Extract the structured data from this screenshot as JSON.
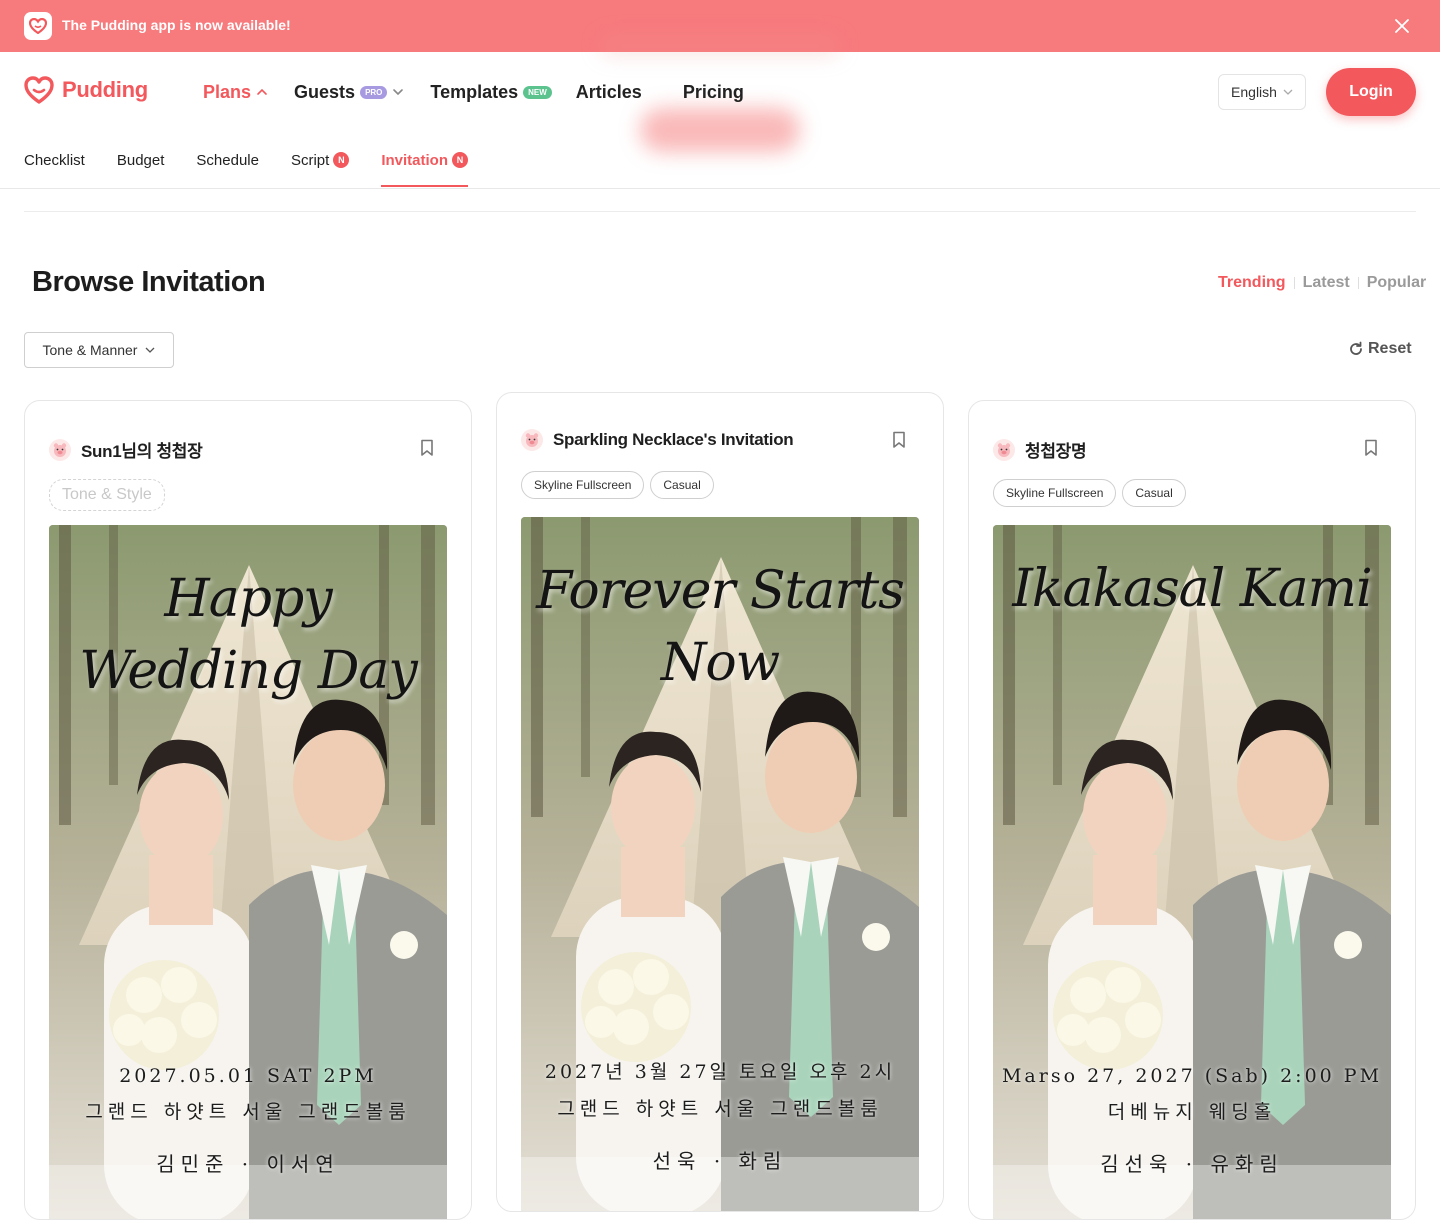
{
  "banner": {
    "text": "The Pudding app is now available!",
    "icon": "pudding-logo-icon",
    "close_icon": "close-icon"
  },
  "header": {
    "logo_text": "Pudding",
    "nav": [
      {
        "label": "Plans",
        "badge": "",
        "chevron": "up"
      },
      {
        "label": "Guests",
        "badge": "PRO",
        "chevron": "down"
      },
      {
        "label": "Templates",
        "badge": "NEW",
        "chevron": ""
      },
      {
        "label": "Articles",
        "badge": "",
        "chevron": ""
      },
      {
        "label": "Pricing",
        "badge": "",
        "chevron": ""
      }
    ],
    "language": "English",
    "login_label": "Login"
  },
  "subnav": [
    {
      "label": "Checklist",
      "badge": ""
    },
    {
      "label": "Budget",
      "badge": ""
    },
    {
      "label": "Schedule",
      "badge": ""
    },
    {
      "label": "Script",
      "badge": "N"
    },
    {
      "label": "Invitation",
      "badge": "N"
    }
  ],
  "page": {
    "title": "Browse Invitation",
    "sort": [
      "Trending",
      "Latest",
      "Popular"
    ],
    "active_sort": "Trending",
    "filter_label": "Tone & Manner",
    "reset_label": "Reset"
  },
  "cards": [
    {
      "title": "Sun1님의 청첩장",
      "tags": [
        "Tone & Style"
      ],
      "script_lines": [
        "Happy",
        "Wedding Day"
      ],
      "date": "2027.05.01 SAT 2PM",
      "venue": "그랜드 하얏트 서울 그랜드볼룸",
      "names": "김민준 · 이서연"
    },
    {
      "title": "Sparkling Necklace's Invitation",
      "tags": [
        "Skyline Fullscreen",
        "Casual"
      ],
      "script_lines": [
        "Forever Starts",
        "Now"
      ],
      "date": "2027년 3월 27일 토요일 오후 2시",
      "venue": "그랜드 하얏트 서울 그랜드볼룸",
      "names": "선욱 · 화림"
    },
    {
      "title": "청첩장명",
      "tags": [
        "Skyline Fullscreen",
        "Casual"
      ],
      "script_lines": [
        "Ikakasal Kami",
        ""
      ],
      "date": "Marso 27, 2027 (Sab) 2:00 PM",
      "venue": "더베뉴지 웨딩홀",
      "names": "김선욱 · 유화림"
    }
  ],
  "colors": {
    "accent": "#f2585c",
    "banner": "#f77a7d",
    "pro_badge": "#a79ae0",
    "new_badge": "#5cc38f"
  }
}
